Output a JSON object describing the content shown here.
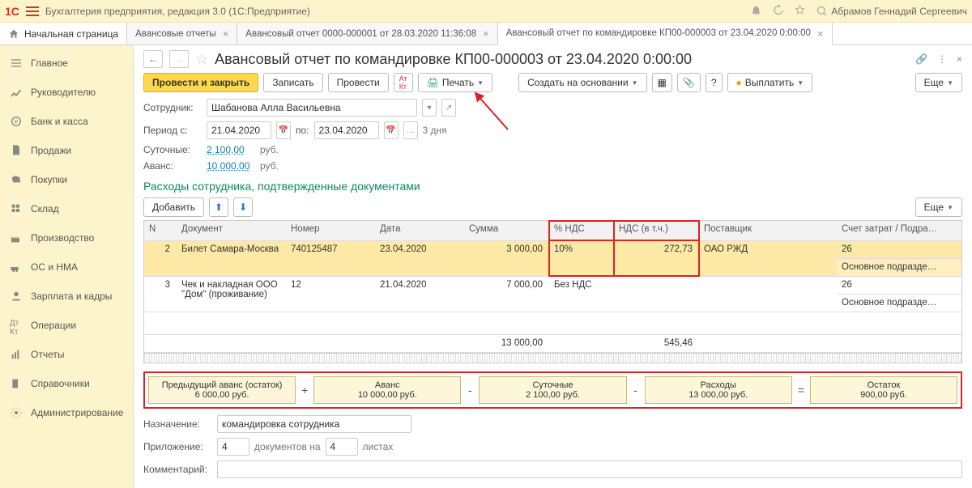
{
  "app": {
    "title": "Бухгалтерия предприятия, редакция 3.0   (1С:Предприятие)",
    "user": "Абрамов Геннадий Сергеевич"
  },
  "tabs": {
    "home": "Начальная страница",
    "t1": "Авансовые отчеты",
    "t2": "Авансовый отчет 0000-000001 от 28.03.2020 11:36:08",
    "t3": "Авансовый отчет по командировке КП00-000003 от 23.04.2020 0:00:00"
  },
  "sidebar": [
    "Главное",
    "Руководителю",
    "Банк и касса",
    "Продажи",
    "Покупки",
    "Склад",
    "Производство",
    "ОС и НМА",
    "Зарплата и кадры",
    "Операции",
    "Отчеты",
    "Справочники",
    "Администрирование"
  ],
  "page": {
    "title": "Авансовый отчет по командировке КП00-000003 от 23.04.2020 0:00:00"
  },
  "toolbar": {
    "post_close": "Провести и закрыть",
    "write": "Записать",
    "post": "Провести",
    "print": "Печать",
    "create_from": "Создать на основании",
    "pay": "Выплатить",
    "more": "Еще"
  },
  "form": {
    "employee_lbl": "Сотрудник:",
    "employee": "Шабанова Алла Васильевна",
    "period_from_lbl": "Период с:",
    "period_from": "21.04.2020",
    "period_to_lbl": "по:",
    "period_to": "23.04.2020",
    "days": "3 дня",
    "perdiem_lbl": "Суточные:",
    "perdiem": "2 100,00",
    "rub": "руб.",
    "advance_lbl": "Аванс:",
    "advance": "10 000,00"
  },
  "section": "Расходы сотрудника, подтвержденные документами",
  "tbl_toolbar": {
    "add": "Добавить",
    "more": "Еще"
  },
  "cols": {
    "n": "N",
    "doc": "Документ",
    "num": "Номер",
    "date": "Дата",
    "sum": "Сумма",
    "vat_pct": "% НДС",
    "vat": "НДС (в т.ч.)",
    "vendor": "Поставщик",
    "acct": "Счет затрат / Подра…"
  },
  "rows": [
    {
      "n": "2",
      "doc": "Билет Самара-Москва",
      "num": "740125487",
      "date": "23.04.2020",
      "sum": "3 000,00",
      "vat_pct": "10%",
      "vat": "272,73",
      "vendor": "ОАО РЖД",
      "acct": "26",
      "sub": "Основное подразде…"
    },
    {
      "n": "3",
      "doc": "Чек и накладная ООО \"Дом\" (проживание)",
      "num": "12",
      "date": "21.04.2020",
      "sum": "7 000,00",
      "vat_pct": "Без НДС",
      "vat": "",
      "vendor": "",
      "acct": "26",
      "sub": "Основное подразде…"
    }
  ],
  "totals": {
    "sum": "13 000,00",
    "vat": "545,46"
  },
  "eq": {
    "prev_t": "Предыдущий аванс (остаток)",
    "prev_v": "6 000,00 руб.",
    "adv_t": "Аванс",
    "adv_v": "10 000,00 руб.",
    "pd_t": "Суточные",
    "pd_v": "2 100,00 руб.",
    "exp_t": "Расходы",
    "exp_v": "13 000,00 руб.",
    "rest_t": "Остаток",
    "rest_v": "900,00 руб."
  },
  "bottom": {
    "purpose_lbl": "Назначение:",
    "purpose": "командировка сотрудника",
    "attach_lbl": "Приложение:",
    "docs_n": "4",
    "docs_txt": "документов на",
    "sheets_n": "4",
    "sheets_txt": "листах",
    "comment_lbl": "Комментарий:"
  }
}
